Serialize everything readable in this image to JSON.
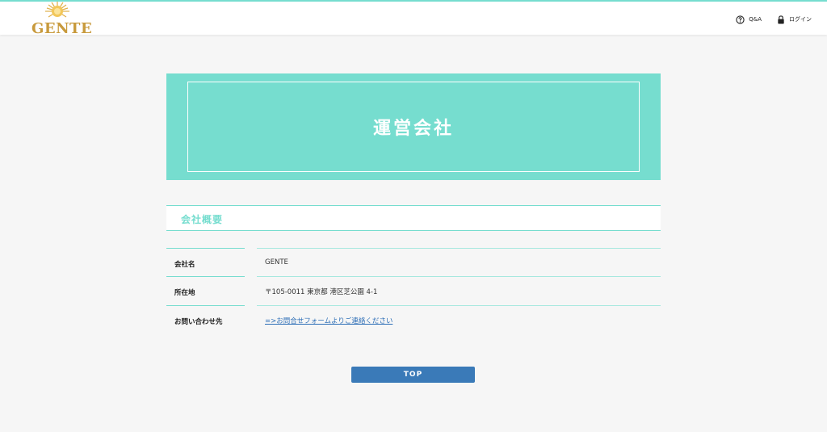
{
  "header": {
    "logo_text": "GENTE",
    "nav": [
      {
        "label": "Q&A",
        "icon": "question-circle-icon"
      },
      {
        "label": "ログイン",
        "icon": "lock-icon"
      }
    ]
  },
  "hero": {
    "title": "運営会社"
  },
  "section": {
    "title": "会社概要",
    "rows": [
      {
        "label": "会社名",
        "value": "GENTE"
      },
      {
        "label": "所在地",
        "value": "〒105-0011 東京都 港区芝公園 4-1"
      },
      {
        "label": "お問い合わせ先",
        "link_text": "=>お問合せフォームよりご連絡ください"
      }
    ]
  },
  "footer": {
    "top_button_label": "TOP"
  },
  "colors": {
    "accent": "#76ddcf",
    "button": "#3a7ab8",
    "logo": "#c89a3c"
  }
}
